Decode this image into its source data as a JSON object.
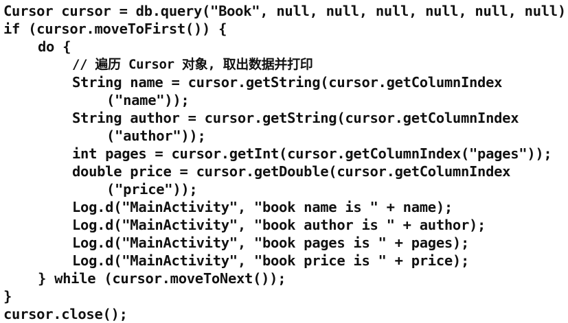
{
  "code": {
    "lines": [
      {
        "indent": 0,
        "text": "Cursor cursor = db.query(\"Book\", null, null, null, null, null, null);"
      },
      {
        "indent": 0,
        "text": "if (cursor.moveToFirst()) {"
      },
      {
        "indent": 1,
        "text": "do {"
      },
      {
        "indent": 2,
        "text": "// 遍历 Cursor 对象, 取出数据并打印"
      },
      {
        "indent": 2,
        "text": "String name = cursor.getString(cursor.getColumnIndex"
      },
      {
        "indent": 3,
        "text": "(\"name\"));"
      },
      {
        "indent": 2,
        "text": "String author = cursor.getString(cursor.getColumnIndex"
      },
      {
        "indent": 3,
        "text": "(\"author\"));"
      },
      {
        "indent": 2,
        "text": "int pages = cursor.getInt(cursor.getColumnIndex(\"pages\"));"
      },
      {
        "indent": 2,
        "text": "double price = cursor.getDouble(cursor.getColumnIndex"
      },
      {
        "indent": 3,
        "text": "(\"price\"));"
      },
      {
        "indent": 2,
        "text": "Log.d(\"MainActivity\", \"book name is \" + name);"
      },
      {
        "indent": 2,
        "text": "Log.d(\"MainActivity\", \"book author is \" + author);"
      },
      {
        "indent": 2,
        "text": "Log.d(\"MainActivity\", \"book pages is \" + pages);"
      },
      {
        "indent": 2,
        "text": "Log.d(\"MainActivity\", \"book price is \" + price);"
      },
      {
        "indent": 1,
        "text": "} while (cursor.moveToNext());"
      },
      {
        "indent": 0,
        "text": "}"
      },
      {
        "indent": 0,
        "text": "cursor.close();"
      }
    ]
  }
}
